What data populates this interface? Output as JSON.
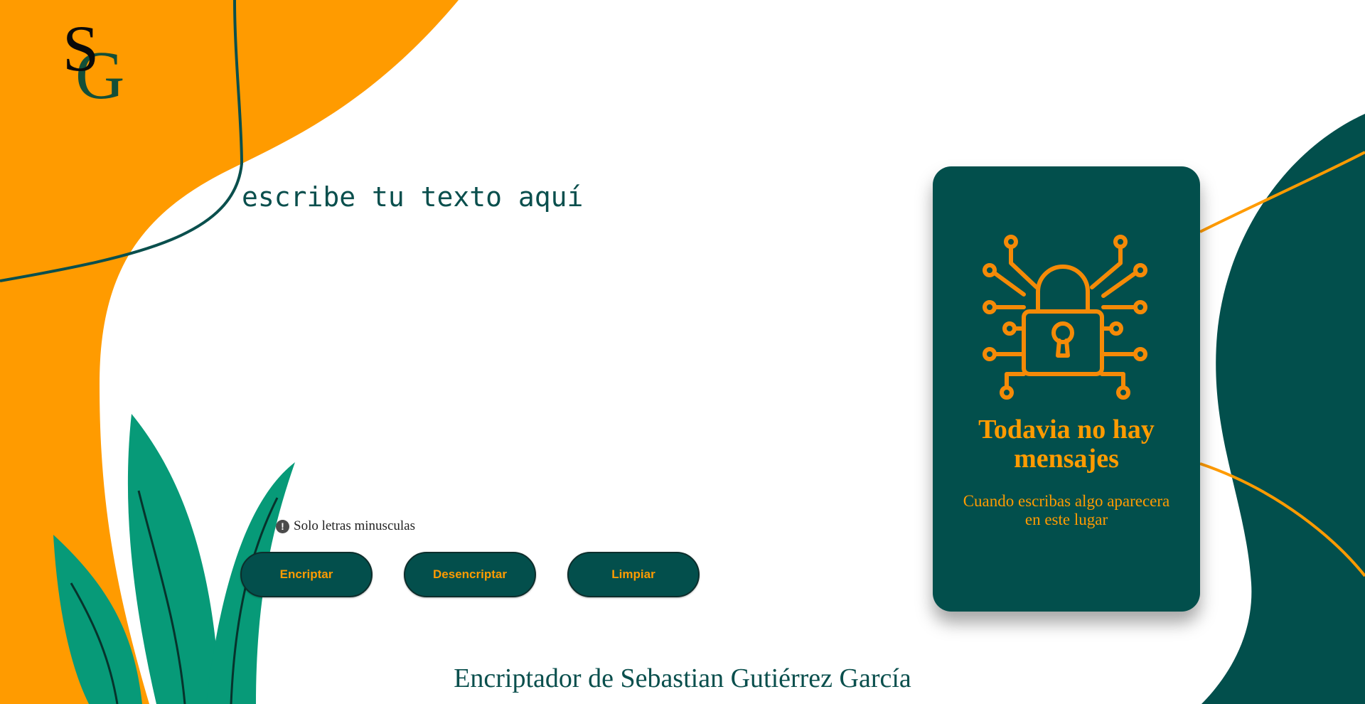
{
  "logo": {
    "letter_1": "S",
    "letter_2": "G"
  },
  "editor": {
    "placeholder": "escribe tu texto aquí"
  },
  "hint": {
    "icon": "exclamation-circle-icon",
    "text": "Solo letras minusculas"
  },
  "buttons": {
    "encrypt": "Encriptar",
    "decrypt": "Desencriptar",
    "clear": "Limpiar"
  },
  "output_card": {
    "icon": "circuit-padlock-icon",
    "title": "Todavia no hay mensajes",
    "subtitle": "Cuando escribas algo aparecera en este lugar"
  },
  "footer": {
    "text": "Encriptador de Sebastian Gutiérrez García"
  },
  "colors": {
    "orange": "#ff9b00",
    "teal": "#024f4c",
    "leaf_green": "#079a78",
    "background": "#ffffff"
  }
}
